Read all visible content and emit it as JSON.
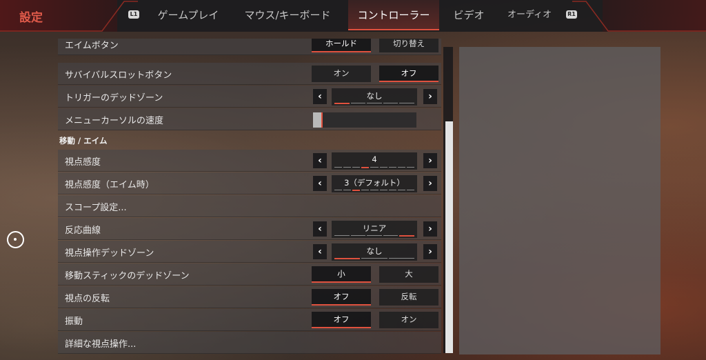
{
  "header": {
    "title": "設定",
    "left_bumper": "L1",
    "right_bumper": "R1",
    "tabs": [
      {
        "label": "ゲームプレイ",
        "active": false
      },
      {
        "label": "マウス/キーボード",
        "active": false
      },
      {
        "label": "コントローラー",
        "active": true
      },
      {
        "label": "ビデオ",
        "active": false
      },
      {
        "label": "オーディオ",
        "active": false
      }
    ]
  },
  "settings": {
    "aim_button": {
      "label": "エイムボタン",
      "options": [
        "ホールド",
        "切り替え"
      ],
      "selected": "ホールド"
    },
    "survival_slot_button": {
      "label": "サバイバルスロットボタン",
      "options": [
        "オン",
        "オフ"
      ],
      "selected": "オフ"
    },
    "trigger_deadzone": {
      "label": "トリガーのデッドゾーン",
      "value": "なし",
      "level_index": 0,
      "levels": 5
    },
    "menu_cursor_speed": {
      "label": "メニューカーソルの速度",
      "fill_fraction": 0.05
    },
    "section_move_aim": "移動 / エイム",
    "look_sensitivity": {
      "label": "視点感度",
      "value": "4",
      "level_index": 3,
      "levels": 9
    },
    "look_sensitivity_ads": {
      "label": "視点感度（エイム時）",
      "value": "3（デフォルト）",
      "level_index": 2,
      "levels": 9
    },
    "scope_settings": {
      "label": "スコープ設定..."
    },
    "response_curve": {
      "label": "反応曲線",
      "value": "リニア",
      "level_index": 4,
      "levels": 5
    },
    "look_deadzone": {
      "label": "視点操作デッドゾーン",
      "value": "なし",
      "level_index": 0,
      "levels": 3
    },
    "move_stick_deadzone": {
      "label": "移動スティックのデッドゾーン",
      "options": [
        "小",
        "大"
      ],
      "selected": "小"
    },
    "invert_look": {
      "label": "視点の反転",
      "options": [
        "オフ",
        "反転"
      ],
      "selected": "オフ"
    },
    "vibration": {
      "label": "振動",
      "options": [
        "オフ",
        "オン"
      ],
      "selected": "オフ"
    },
    "advanced_look": {
      "label": "詳細な視点操作..."
    }
  },
  "arrows": {
    "left": "‹",
    "right": "›"
  },
  "colors": {
    "accent": "#e0513e",
    "title_red": "#e05a4a",
    "row_bg": "#464648",
    "button_bg": "#1e1e20"
  }
}
